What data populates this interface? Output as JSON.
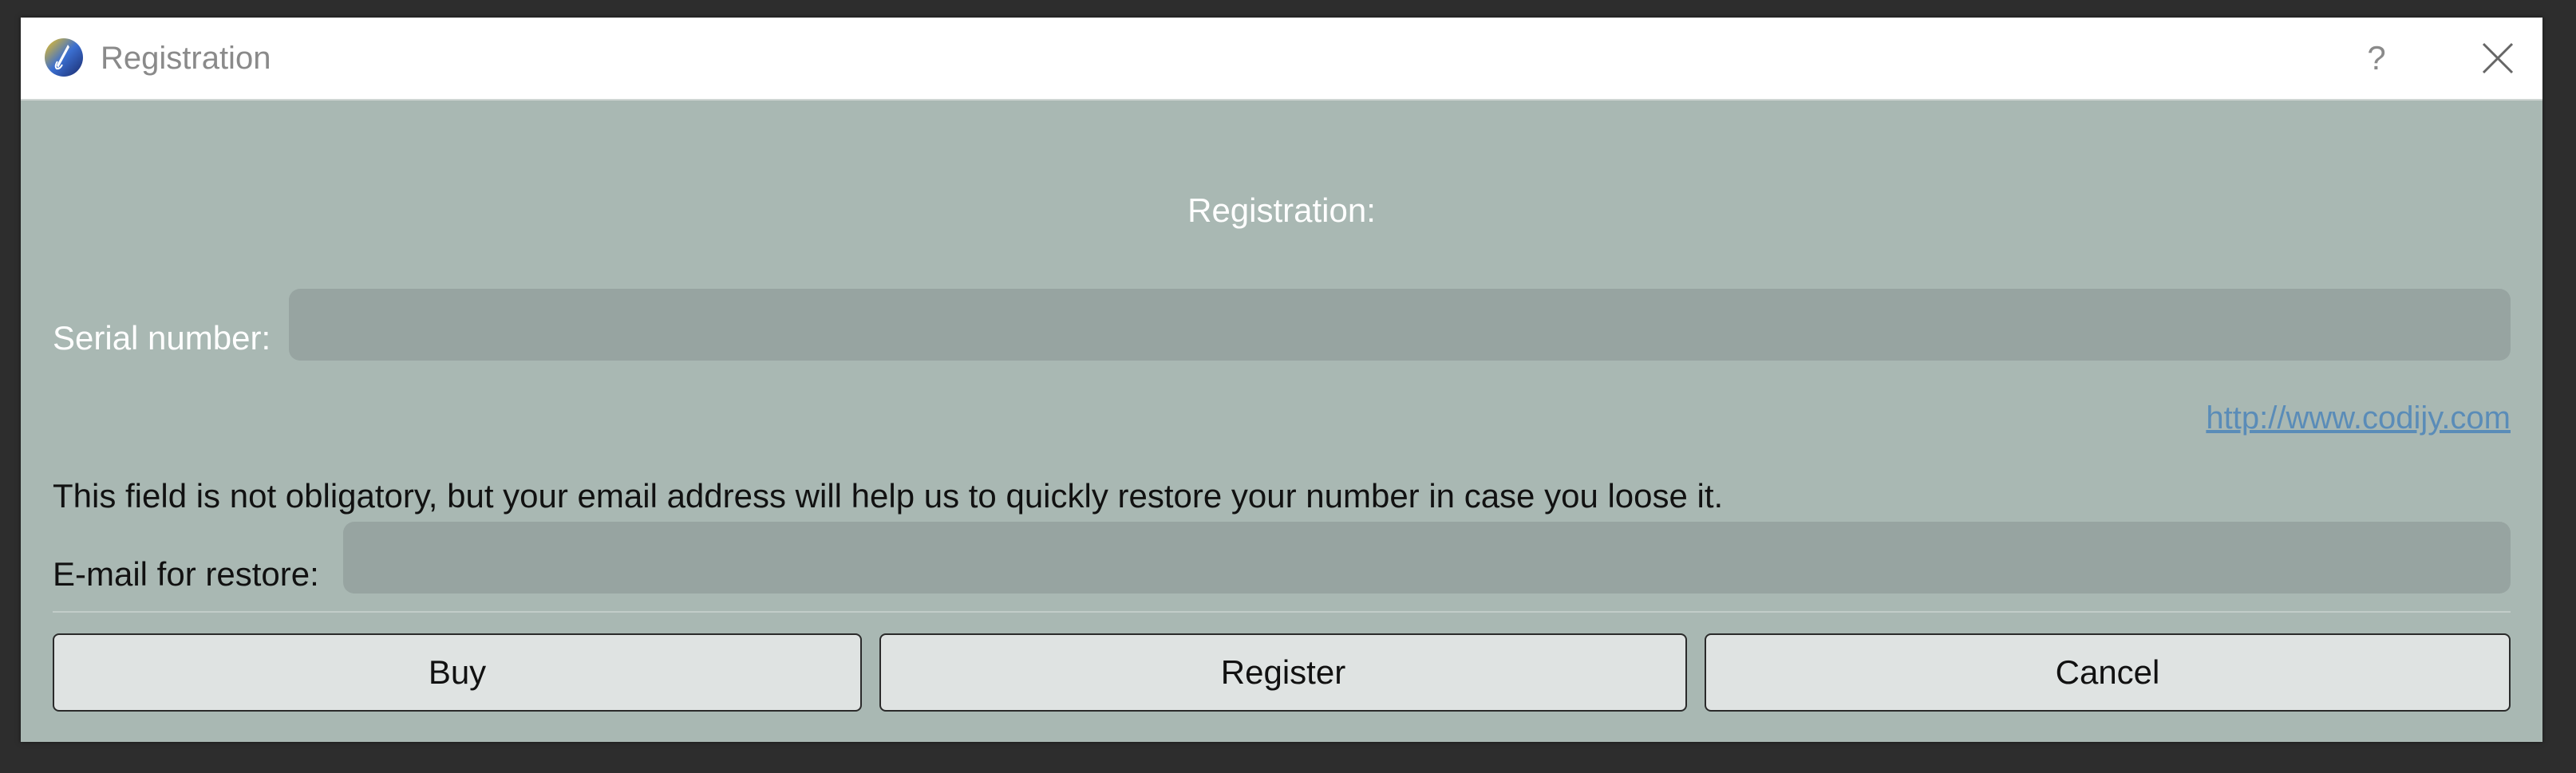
{
  "window": {
    "title": "Registration",
    "help_glyph": "?",
    "close_icon": "close-icon",
    "app_icon": "app-logo-icon"
  },
  "form": {
    "heading": "Registration:",
    "serial_label": "Serial number:",
    "serial_value": "",
    "link_text": "http://www.codijy.com",
    "info_text": "This field is not obligatory, but your email address will help us to quickly restore your number in case you loose it.",
    "email_label": "E-mail for restore:",
    "email_value": ""
  },
  "buttons": {
    "buy": "Buy",
    "register": "Register",
    "cancel": "Cancel"
  },
  "colors": {
    "dialog_background": "#a9b8b3",
    "input_background": "#97a4a1",
    "link": "#5a8cb8"
  }
}
